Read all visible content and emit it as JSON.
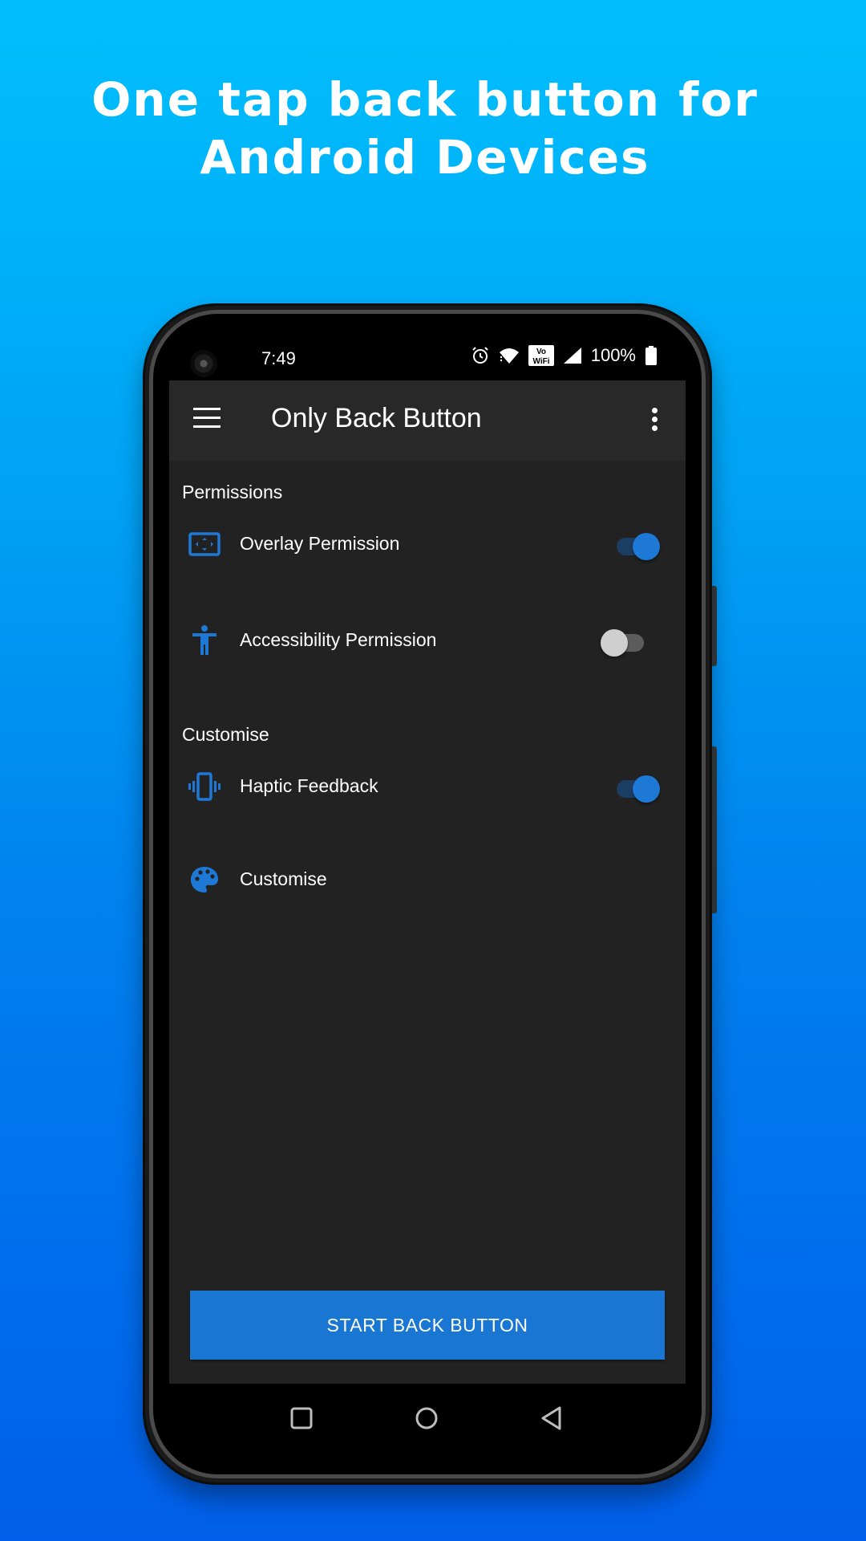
{
  "promo": {
    "line1": "One tap back button for",
    "line2": "Android Devices"
  },
  "status_bar": {
    "time": "7:49",
    "icons": [
      "alarm-icon",
      "wifi-icon",
      "vowifi-icon",
      "cellular-signal-icon",
      "battery-icon"
    ],
    "vowifi_label_top": "Vo",
    "vowifi_label_bottom": "WiFi",
    "battery_percent": "100%"
  },
  "app_bar": {
    "title": "Only Back Button",
    "menu_icon": "hamburger-menu-icon",
    "overflow_icon": "more-vert-icon"
  },
  "sections": [
    {
      "header": "Permissions",
      "items": [
        {
          "label": "Overlay Permission",
          "icon": "overlay-icon",
          "toggle": true,
          "checked": true
        },
        {
          "label": "Accessibility Permission",
          "icon": "accessibility-icon",
          "toggle": true,
          "checked": false
        }
      ]
    },
    {
      "header": "Customise",
      "items": [
        {
          "label": "Haptic Feedback",
          "icon": "vibration-icon",
          "toggle": true,
          "checked": true
        },
        {
          "label": "Customise",
          "icon": "palette-icon",
          "toggle": false
        }
      ]
    }
  ],
  "primary_action": {
    "label": "START BACK BUTTON"
  },
  "nav_bar": {
    "buttons": [
      "recents-icon",
      "home-icon",
      "back-icon"
    ]
  },
  "colors": {
    "accent": "#1976d2",
    "icon_blue": "#1d78d6",
    "background_top": "#00bffc",
    "background_bottom": "#005fea",
    "surface": "#222222",
    "app_bar": "#282828"
  }
}
